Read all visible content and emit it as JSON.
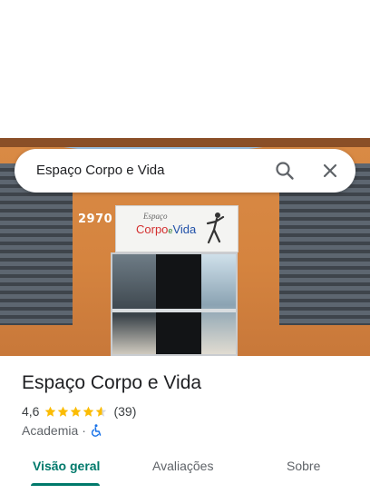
{
  "search": {
    "query": "Espaço Corpo e Vida",
    "search_icon": "search-icon",
    "close_icon": "close-icon"
  },
  "photo": {
    "building_number": "2970",
    "sign_line1": "Espaço",
    "sign_brand_corpo": "Corpo",
    "sign_brand_e": "e",
    "sign_brand_vida": "Vida"
  },
  "place": {
    "name": "Espaço Corpo e Vida",
    "rating": "4,6",
    "rating_value": 4.6,
    "rating_max": 5,
    "review_count": "(39)",
    "category": "Academia",
    "separator": "·",
    "accessibility_icon": "wheelchair-icon"
  },
  "tabs": [
    {
      "label": "Visão geral",
      "selected": true
    },
    {
      "label": "Avaliações",
      "selected": false
    },
    {
      "label": "Sobre",
      "selected": false
    }
  ],
  "colors": {
    "accent": "#00796b",
    "star": "#fbbc04",
    "accessibility": "#1a73e8"
  }
}
